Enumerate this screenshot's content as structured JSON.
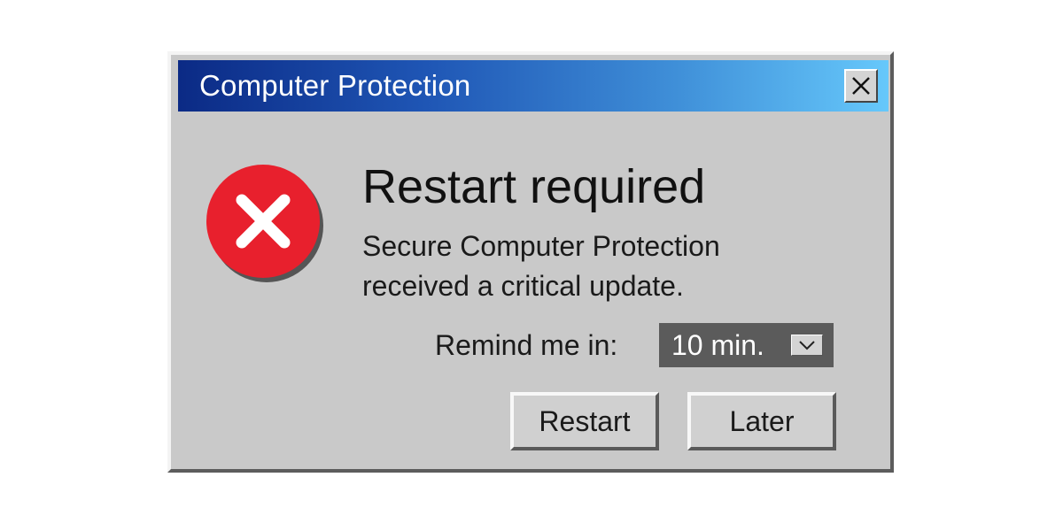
{
  "window": {
    "title": "Computer Protection",
    "close_icon": "close-icon"
  },
  "message": {
    "icon": "error-icon",
    "headline": "Restart required",
    "line1": "Secure Computer Protection",
    "line2": "received a critical update."
  },
  "remind": {
    "label": "Remind me in:",
    "selected": "10 min.",
    "dropdown_icon": "chevron-down-icon"
  },
  "buttons": {
    "restart_label": "Restart",
    "later_label": "Later"
  },
  "colors": {
    "titlebar_start": "#0b2a85",
    "titlebar_end": "#66c8fb",
    "dialog_bg": "#c9c9c9",
    "error_red": "#e8202d"
  }
}
